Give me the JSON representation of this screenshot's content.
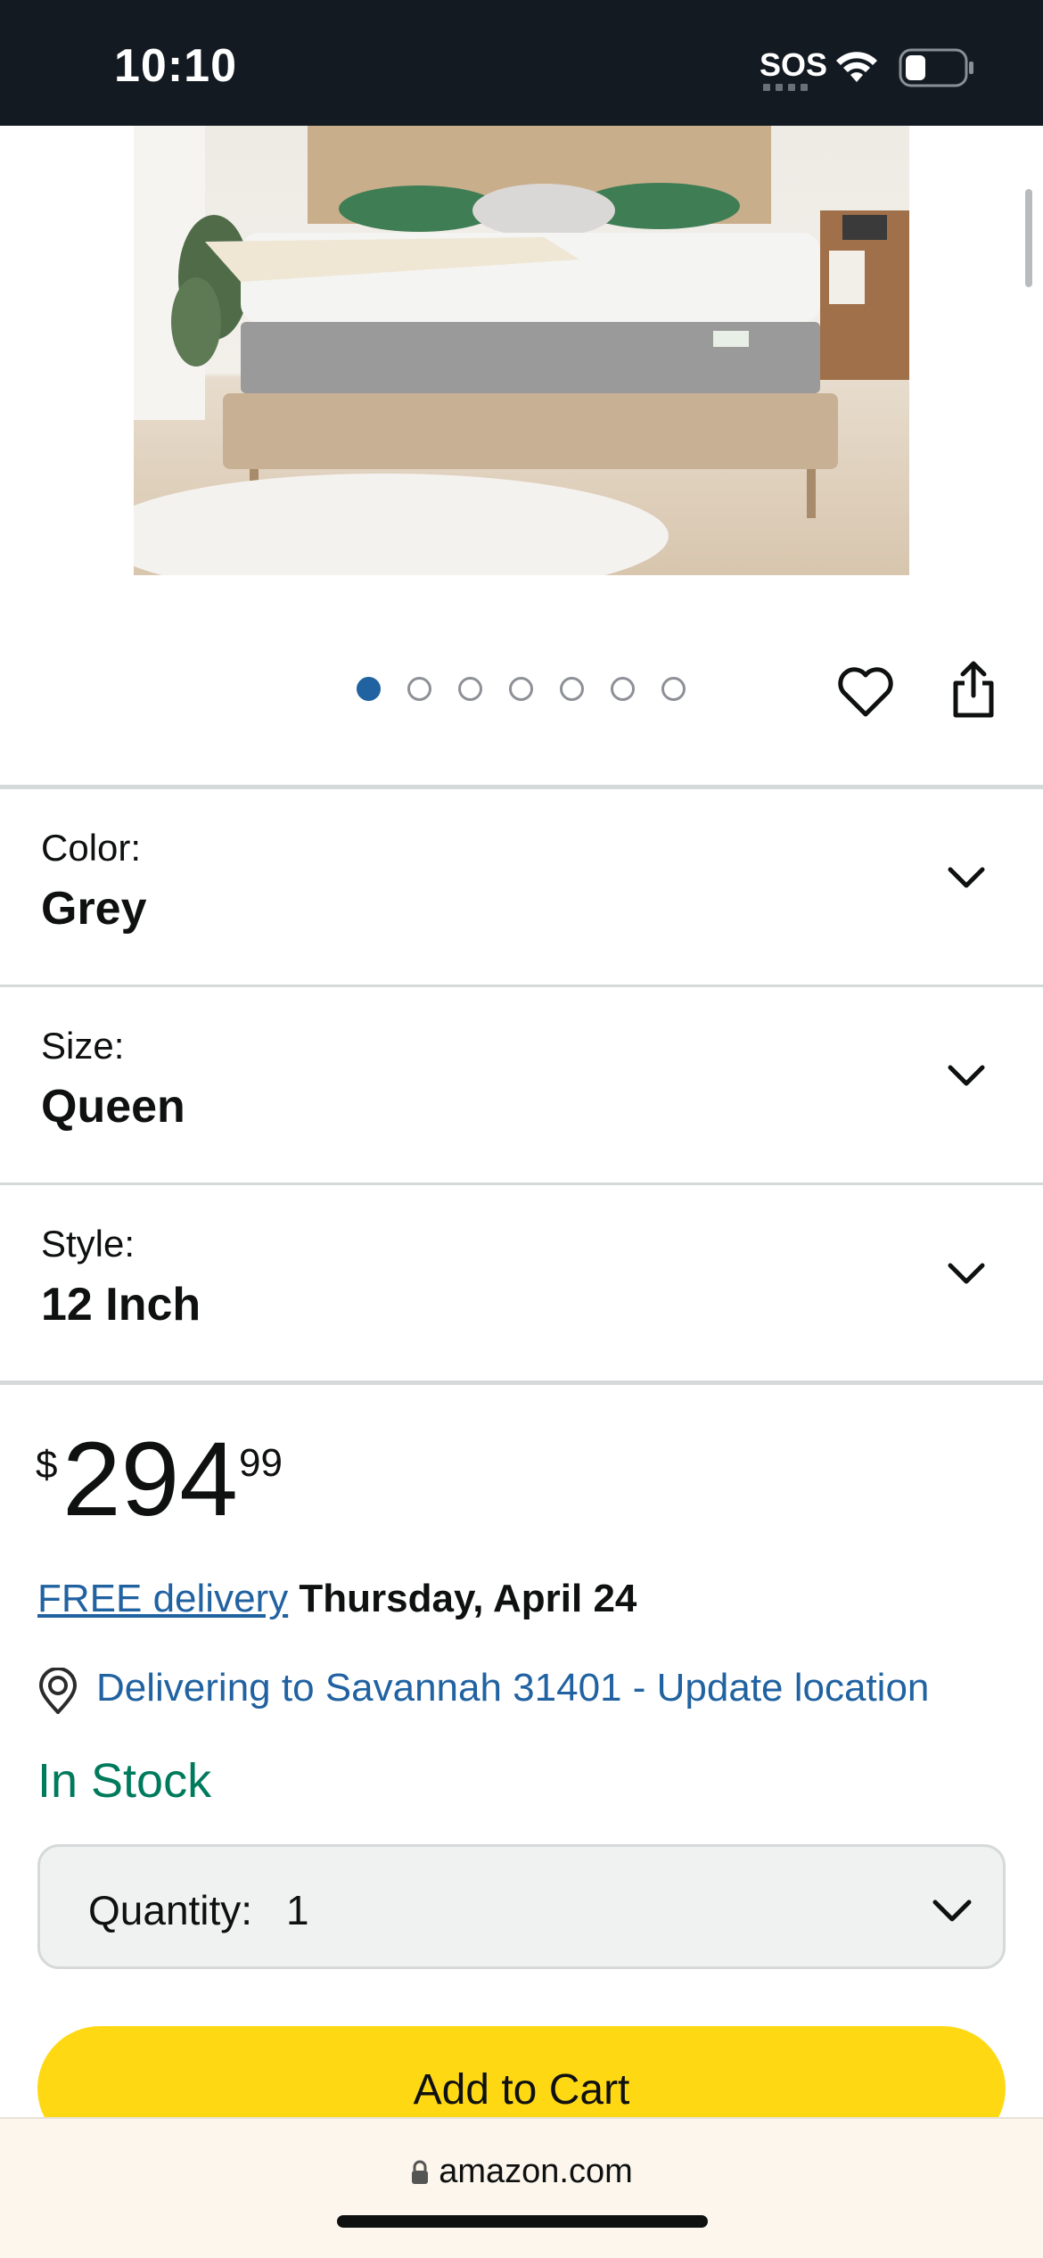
{
  "status_bar": {
    "time": "10:10",
    "sos": "SOS"
  },
  "product": {
    "image_alt": "mattress-on-bed-photo",
    "carousel": {
      "count": 7,
      "active_index": 0
    }
  },
  "variations": [
    {
      "label": "Color:",
      "value": "Grey"
    },
    {
      "label": "Size:",
      "value": "Queen"
    },
    {
      "label": "Style:",
      "value": "12 Inch"
    }
  ],
  "price": {
    "symbol": "$",
    "whole": "294",
    "fraction": "99"
  },
  "delivery": {
    "link_text": "FREE delivery",
    "date": "Thursday, April 24",
    "location_text": "Delivering to Savannah 31401 - Update location"
  },
  "stock": {
    "status": "In Stock"
  },
  "quantity": {
    "label": "Quantity:",
    "value": "1"
  },
  "cart": {
    "add_label": "Add to Cart"
  },
  "browser": {
    "url": "amazon.com"
  },
  "colors": {
    "link": "#2162a1",
    "in_stock": "#007a5c",
    "add_to_cart": "#ffd814",
    "status_bar": "#131a22"
  },
  "icons": [
    "wifi-icon",
    "battery-icon",
    "heart-icon",
    "share-icon",
    "chevron-down-icon",
    "location-pin-icon",
    "lock-icon"
  ]
}
